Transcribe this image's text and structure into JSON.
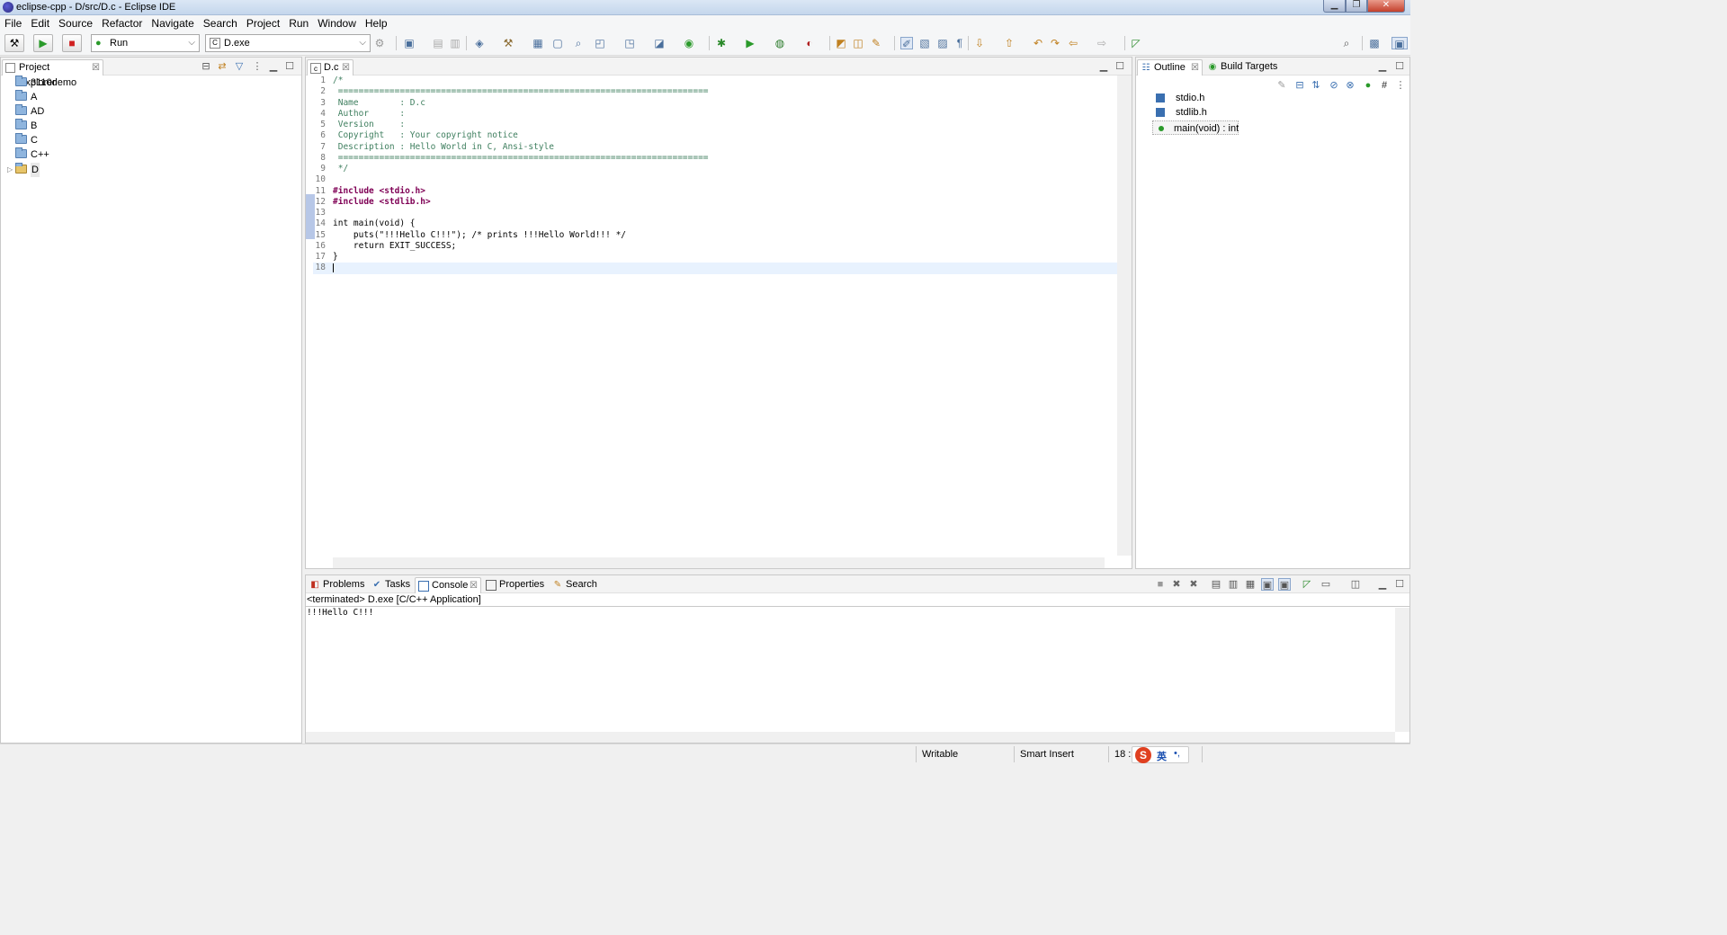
{
  "window": {
    "title": "eclipse-cpp - D/src/D.c - Eclipse IDE"
  },
  "menu": [
    "File",
    "Edit",
    "Source",
    "Refactor",
    "Navigate",
    "Search",
    "Project",
    "Run",
    "Window",
    "Help"
  ],
  "toolbar": {
    "launch_mode": "Run",
    "launch_config": "D.exe"
  },
  "project_explorer": {
    "title": "Project Explorer",
    "items": [
      {
        "label": "3110demo"
      },
      {
        "label": "A"
      },
      {
        "label": "AD"
      },
      {
        "label": "B"
      },
      {
        "label": "C"
      },
      {
        "label": "C++"
      },
      {
        "label": "D"
      }
    ]
  },
  "editor": {
    "tab": "D.c",
    "lines": [
      {
        "n": "1",
        "t": "/*"
      },
      {
        "n": "2",
        "t": " ========================================================================"
      },
      {
        "n": "3",
        "t": " Name        : D.c"
      },
      {
        "n": "4",
        "t": " Author      : "
      },
      {
        "n": "5",
        "t": " Version     :"
      },
      {
        "n": "6",
        "t": " Copyright   : Your copyright notice"
      },
      {
        "n": "7",
        "t": " Description : Hello World in C, Ansi-style"
      },
      {
        "n": "8",
        "t": " ========================================================================"
      },
      {
        "n": "9",
        "t": " */"
      },
      {
        "n": "10",
        "t": ""
      },
      {
        "n": "11",
        "t": "#include <stdio.h>"
      },
      {
        "n": "12",
        "t": "#include <stdlib.h>"
      },
      {
        "n": "13",
        "t": ""
      },
      {
        "n": "14",
        "t": "int main(void) {"
      },
      {
        "n": "15",
        "t": "    puts(\"!!!Hello C!!!\"); /* prints !!!Hello World!!! */"
      },
      {
        "n": "16",
        "t": "    return EXIT_SUCCESS;"
      },
      {
        "n": "17",
        "t": "}"
      },
      {
        "n": "18",
        "t": ""
      }
    ]
  },
  "outline": {
    "tabs": [
      "Outline",
      "Build Targets"
    ],
    "items": [
      {
        "label": "stdio.h"
      },
      {
        "label": "stdlib.h"
      },
      {
        "label": "main(void) : int"
      }
    ]
  },
  "bottom_panel": {
    "tabs": [
      "Problems",
      "Tasks",
      "Console",
      "Properties",
      "Search"
    ],
    "console_header": "<terminated> D.exe [C/C++ Application]",
    "console_output": "!!!Hello C!!!"
  },
  "status": {
    "writable": "Writable",
    "insert_mode": "Smart Insert",
    "position": "18 :",
    "ime": "英"
  }
}
